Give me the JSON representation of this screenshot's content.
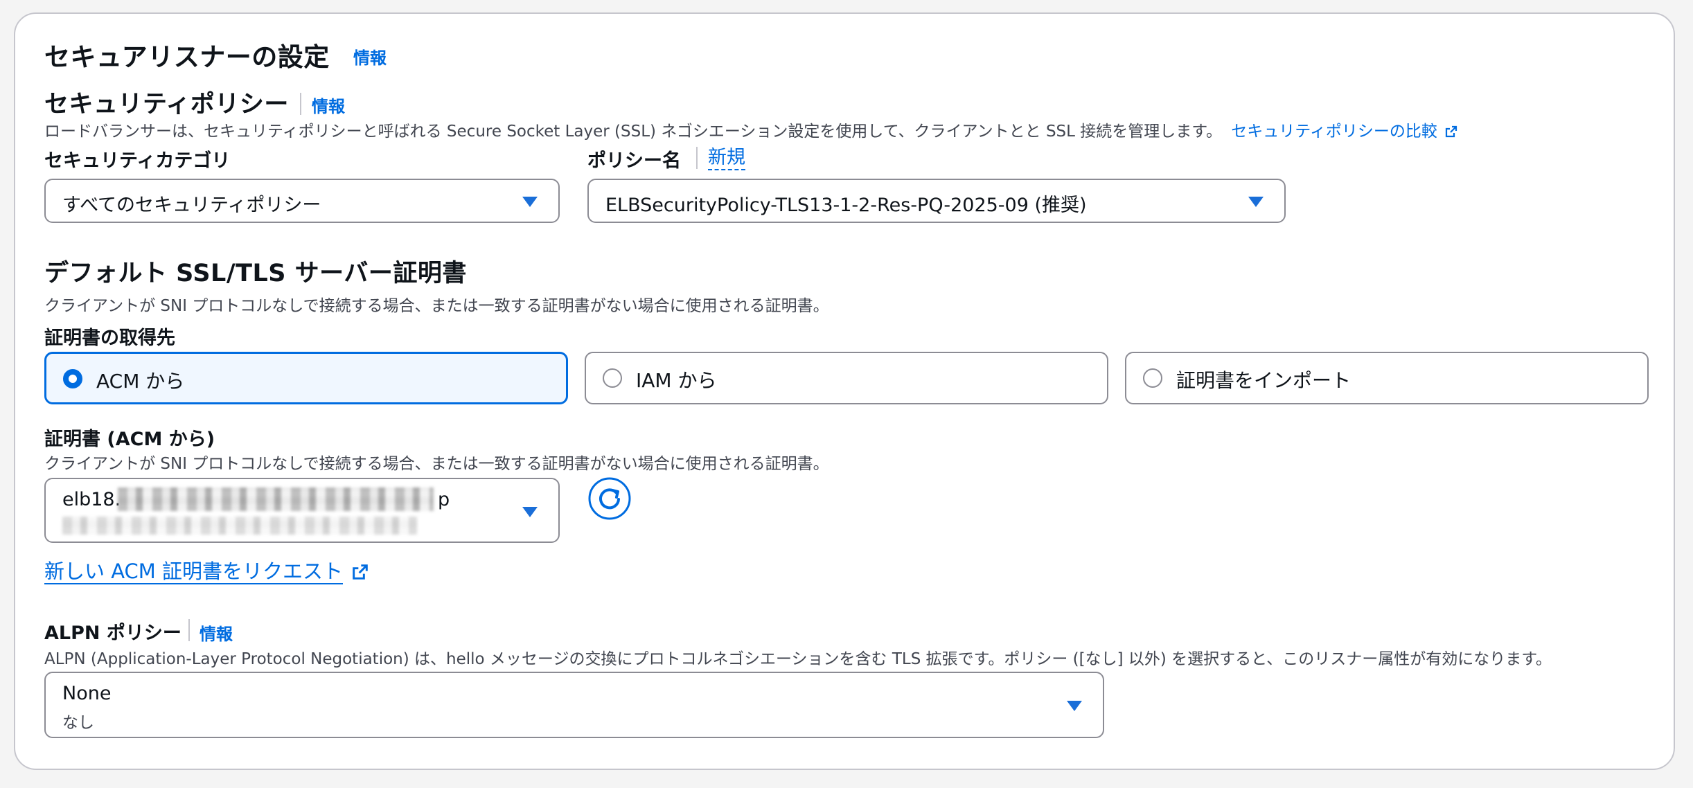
{
  "section": {
    "title": "セキュアリスナーの設定",
    "info": "情報"
  },
  "security_policy": {
    "title": "セキュリティポリシー",
    "info": "情報",
    "description": "ロードバランサーは、セキュリティポリシーと呼ばれる Secure Socket Layer (SSL) ネゴシエーション設定を使用して、クライアントとと SSL 接続を管理します。",
    "compare_link": "セキュリティポリシーの比較",
    "category_label": "セキュリティカテゴリ",
    "category_value": "すべてのセキュリティポリシー",
    "policy_name_label": "ポリシー名",
    "policy_new_link": "新規",
    "policy_value": "ELBSecurityPolicy-TLS13-1-2-Res-PQ-2025-09 (推奨)"
  },
  "default_cert": {
    "title": "デフォルト SSL/TLS サーバー証明書",
    "description": "クライアントが SNI プロトコルなしで接続する場合、または一致する証明書がない場合に使用される証明書。",
    "source_label": "証明書の取得先",
    "sources": [
      {
        "label": "ACM から",
        "selected": true
      },
      {
        "label": "IAM から",
        "selected": false
      },
      {
        "label": "証明書をインポート",
        "selected": false
      }
    ],
    "cert_label": "証明書 (ACM から)",
    "cert_description": "クライアントが SNI プロトコルなしで接続する場合、または一致する証明書がない場合に使用される証明書。",
    "cert_value_prefix": "elb18.",
    "cert_value_suffix": "p",
    "request_link": "新しい ACM 証明書をリクエスト"
  },
  "alpn": {
    "title": "ALPN ポリシー",
    "info": "情報",
    "description": "ALPN (Application-Layer Protocol Negotiation) は、hello メッセージの交換にプロトコルネゴシエーションを含む TLS 拡張です。ポリシー ([なし] 以外) を選択すると、このリスナー属性が有効になります。",
    "value": "None",
    "value_sub": "なし"
  },
  "icons": {
    "external": "external-link-icon",
    "refresh": "refresh-icon",
    "caret": "caret-down-icon"
  },
  "colors": {
    "link": "#006ce0",
    "selected_tile_bg": "#f0f7ff",
    "border": "#8c8c94"
  }
}
